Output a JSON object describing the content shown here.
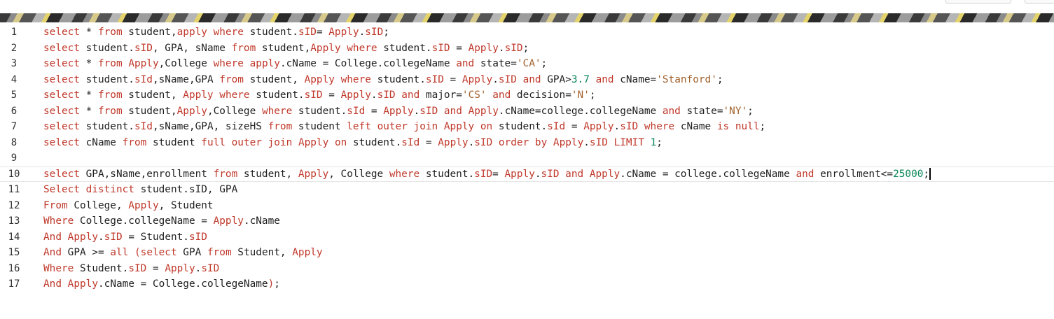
{
  "editor": {
    "colors": {
      "keyword": "#c0392b",
      "string": "#a2622d",
      "number": "#098658",
      "text": "#1f1f1f",
      "gutter": "#333333"
    },
    "active_line": 10,
    "lines": [
      {
        "n": "1",
        "tokens": [
          [
            "kw",
            "select"
          ],
          [
            "plain",
            " * "
          ],
          [
            "kw",
            "from"
          ],
          [
            "plain",
            " student,"
          ],
          [
            "kw",
            "apply"
          ],
          [
            "plain",
            " "
          ],
          [
            "kw",
            "where"
          ],
          [
            "plain",
            " student."
          ],
          [
            "kw",
            "sID"
          ],
          [
            "plain",
            "= "
          ],
          [
            "kw",
            "Apply"
          ],
          [
            "plain",
            "."
          ],
          [
            "kw",
            "sID"
          ],
          [
            "plain",
            ";"
          ]
        ]
      },
      {
        "n": "2",
        "tokens": [
          [
            "kw",
            "select"
          ],
          [
            "plain",
            " student."
          ],
          [
            "kw",
            "sID"
          ],
          [
            "plain",
            ", GPA, sName "
          ],
          [
            "kw",
            "from"
          ],
          [
            "plain",
            " student,"
          ],
          [
            "kw",
            "Apply"
          ],
          [
            "plain",
            " "
          ],
          [
            "kw",
            "where"
          ],
          [
            "plain",
            " student."
          ],
          [
            "kw",
            "sID"
          ],
          [
            "plain",
            " = "
          ],
          [
            "kw",
            "Apply"
          ],
          [
            "plain",
            "."
          ],
          [
            "kw",
            "sID"
          ],
          [
            "plain",
            ";"
          ]
        ]
      },
      {
        "n": "3",
        "tokens": [
          [
            "kw",
            "select"
          ],
          [
            "plain",
            " * "
          ],
          [
            "kw",
            "from"
          ],
          [
            "plain",
            " "
          ],
          [
            "kw",
            "Apply"
          ],
          [
            "plain",
            ",College "
          ],
          [
            "kw",
            "where"
          ],
          [
            "plain",
            " "
          ],
          [
            "kw",
            "apply"
          ],
          [
            "plain",
            ".cName = College.collegeName "
          ],
          [
            "kw",
            "and"
          ],
          [
            "plain",
            " state="
          ],
          [
            "str",
            "'CA'"
          ],
          [
            "plain",
            ";"
          ]
        ]
      },
      {
        "n": "4",
        "tokens": [
          [
            "kw",
            "select"
          ],
          [
            "plain",
            " student."
          ],
          [
            "kw",
            "sId"
          ],
          [
            "plain",
            ",sName,GPA "
          ],
          [
            "kw",
            "from"
          ],
          [
            "plain",
            " student, "
          ],
          [
            "kw",
            "Apply"
          ],
          [
            "plain",
            " "
          ],
          [
            "kw",
            "where"
          ],
          [
            "plain",
            " student."
          ],
          [
            "kw",
            "sID"
          ],
          [
            "plain",
            " = "
          ],
          [
            "kw",
            "Apply"
          ],
          [
            "plain",
            "."
          ],
          [
            "kw",
            "sID"
          ],
          [
            "plain",
            " "
          ],
          [
            "kw",
            "and"
          ],
          [
            "plain",
            " GPA>"
          ],
          [
            "num",
            "3.7"
          ],
          [
            "plain",
            " "
          ],
          [
            "kw",
            "and"
          ],
          [
            "plain",
            " cName="
          ],
          [
            "str",
            "'Stanford'"
          ],
          [
            "plain",
            ";"
          ]
        ]
      },
      {
        "n": "5",
        "tokens": [
          [
            "kw",
            "select"
          ],
          [
            "plain",
            " * "
          ],
          [
            "kw",
            "from"
          ],
          [
            "plain",
            " student, "
          ],
          [
            "kw",
            "Apply"
          ],
          [
            "plain",
            " "
          ],
          [
            "kw",
            "where"
          ],
          [
            "plain",
            " student."
          ],
          [
            "kw",
            "sID"
          ],
          [
            "plain",
            " = "
          ],
          [
            "kw",
            "Apply"
          ],
          [
            "plain",
            "."
          ],
          [
            "kw",
            "sID"
          ],
          [
            "plain",
            " "
          ],
          [
            "kw",
            "and"
          ],
          [
            "plain",
            " major="
          ],
          [
            "str",
            "'CS'"
          ],
          [
            "plain",
            " "
          ],
          [
            "kw",
            "and"
          ],
          [
            "plain",
            " decision="
          ],
          [
            "str",
            "'N'"
          ],
          [
            "plain",
            ";"
          ]
        ]
      },
      {
        "n": "6",
        "tokens": [
          [
            "kw",
            "select"
          ],
          [
            "plain",
            " * "
          ],
          [
            "kw",
            "from"
          ],
          [
            "plain",
            " student,"
          ],
          [
            "kw",
            "Apply"
          ],
          [
            "plain",
            ",College "
          ],
          [
            "kw",
            "where"
          ],
          [
            "plain",
            " student."
          ],
          [
            "kw",
            "sId"
          ],
          [
            "plain",
            " = "
          ],
          [
            "kw",
            "Apply"
          ],
          [
            "plain",
            "."
          ],
          [
            "kw",
            "sID"
          ],
          [
            "plain",
            " "
          ],
          [
            "kw",
            "and"
          ],
          [
            "plain",
            " "
          ],
          [
            "kw",
            "Apply"
          ],
          [
            "plain",
            ".cName=college.collegeName "
          ],
          [
            "kw",
            "and"
          ],
          [
            "plain",
            " state="
          ],
          [
            "str",
            "'NY'"
          ],
          [
            "plain",
            ";"
          ]
        ]
      },
      {
        "n": "7",
        "tokens": [
          [
            "kw",
            "select"
          ],
          [
            "plain",
            " student."
          ],
          [
            "kw",
            "sId"
          ],
          [
            "plain",
            ",sName,GPA, sizeHS "
          ],
          [
            "kw",
            "from"
          ],
          [
            "plain",
            " student "
          ],
          [
            "kw",
            "left"
          ],
          [
            "plain",
            " "
          ],
          [
            "kw",
            "outer"
          ],
          [
            "plain",
            " "
          ],
          [
            "kw",
            "join"
          ],
          [
            "plain",
            " "
          ],
          [
            "kw",
            "Apply"
          ],
          [
            "plain",
            " "
          ],
          [
            "kw",
            "on"
          ],
          [
            "plain",
            " student."
          ],
          [
            "kw",
            "sId"
          ],
          [
            "plain",
            " = "
          ],
          [
            "kw",
            "Apply"
          ],
          [
            "plain",
            "."
          ],
          [
            "kw",
            "sID"
          ],
          [
            "plain",
            " "
          ],
          [
            "kw",
            "where"
          ],
          [
            "plain",
            " cName "
          ],
          [
            "kw",
            "is"
          ],
          [
            "plain",
            " "
          ],
          [
            "kw",
            "null"
          ],
          [
            "plain",
            ";"
          ]
        ]
      },
      {
        "n": "8",
        "tokens": [
          [
            "kw",
            "select"
          ],
          [
            "plain",
            " cName "
          ],
          [
            "kw",
            "from"
          ],
          [
            "plain",
            " student "
          ],
          [
            "kw",
            "full"
          ],
          [
            "plain",
            " "
          ],
          [
            "kw",
            "outer"
          ],
          [
            "plain",
            " "
          ],
          [
            "kw",
            "join"
          ],
          [
            "plain",
            " "
          ],
          [
            "kw",
            "Apply"
          ],
          [
            "plain",
            " "
          ],
          [
            "kw",
            "on"
          ],
          [
            "plain",
            " student."
          ],
          [
            "kw",
            "sId"
          ],
          [
            "plain",
            " = "
          ],
          [
            "kw",
            "Apply"
          ],
          [
            "plain",
            "."
          ],
          [
            "kw",
            "sID"
          ],
          [
            "plain",
            " "
          ],
          [
            "kw",
            "order"
          ],
          [
            "plain",
            " "
          ],
          [
            "kw",
            "by"
          ],
          [
            "plain",
            " "
          ],
          [
            "kw",
            "Apply"
          ],
          [
            "plain",
            "."
          ],
          [
            "kw",
            "sID"
          ],
          [
            "plain",
            " "
          ],
          [
            "kw",
            "LIMIT"
          ],
          [
            "plain",
            " "
          ],
          [
            "num",
            "1"
          ],
          [
            "plain",
            ";"
          ]
        ]
      },
      {
        "n": "9",
        "tokens": []
      },
      {
        "n": "10",
        "tokens": [
          [
            "kw",
            "select"
          ],
          [
            "plain",
            " GPA,sName,enrollment "
          ],
          [
            "kw",
            "from"
          ],
          [
            "plain",
            " student, "
          ],
          [
            "kw",
            "Apply"
          ],
          [
            "plain",
            ", College "
          ],
          [
            "kw",
            "where"
          ],
          [
            "plain",
            " student."
          ],
          [
            "kw",
            "sID"
          ],
          [
            "plain",
            "= "
          ],
          [
            "kw",
            "Apply"
          ],
          [
            "plain",
            "."
          ],
          [
            "kw",
            "sID"
          ],
          [
            "plain",
            " "
          ],
          [
            "kw",
            "and"
          ],
          [
            "plain",
            " "
          ],
          [
            "kw",
            "Apply"
          ],
          [
            "plain",
            ".cName = college.collegeName "
          ],
          [
            "kw",
            "and"
          ],
          [
            "plain",
            " enrollment<="
          ],
          [
            "num",
            "25000"
          ],
          [
            "plain",
            ";"
          ]
        ]
      },
      {
        "n": "11",
        "tokens": [
          [
            "kw",
            "Select"
          ],
          [
            "plain",
            " "
          ],
          [
            "kw",
            "distinct"
          ],
          [
            "plain",
            " student.sID, GPA"
          ]
        ]
      },
      {
        "n": "12",
        "tokens": [
          [
            "kw",
            "From"
          ],
          [
            "plain",
            " College, "
          ],
          [
            "kw",
            "Apply"
          ],
          [
            "plain",
            ", Student"
          ]
        ]
      },
      {
        "n": "13",
        "tokens": [
          [
            "kw",
            "Where"
          ],
          [
            "plain",
            " College.collegeName = "
          ],
          [
            "kw",
            "Apply"
          ],
          [
            "plain",
            ".cName"
          ]
        ]
      },
      {
        "n": "14",
        "tokens": [
          [
            "kw",
            "And"
          ],
          [
            "plain",
            " "
          ],
          [
            "kw",
            "Apply"
          ],
          [
            "plain",
            "."
          ],
          [
            "kw",
            "sID"
          ],
          [
            "plain",
            " = Student."
          ],
          [
            "kw",
            "sID"
          ]
        ]
      },
      {
        "n": "15",
        "tokens": [
          [
            "kw",
            "And"
          ],
          [
            "plain",
            " GPA >= "
          ],
          [
            "kw",
            "all"
          ],
          [
            "plain",
            " "
          ],
          [
            "kw",
            "("
          ],
          [
            "kw",
            "select"
          ],
          [
            "plain",
            " GPA "
          ],
          [
            "kw",
            "from"
          ],
          [
            "plain",
            " Student, "
          ],
          [
            "kw",
            "Apply"
          ]
        ]
      },
      {
        "n": "16",
        "tokens": [
          [
            "kw",
            "Where"
          ],
          [
            "plain",
            " Student."
          ],
          [
            "kw",
            "sID"
          ],
          [
            "plain",
            " = "
          ],
          [
            "kw",
            "Apply"
          ],
          [
            "plain",
            "."
          ],
          [
            "kw",
            "sID"
          ]
        ]
      },
      {
        "n": "17",
        "tokens": [
          [
            "kw",
            "And"
          ],
          [
            "plain",
            " "
          ],
          [
            "kw",
            "Apply"
          ],
          [
            "plain",
            ".cName = College.collegeName"
          ],
          [
            "kw",
            ")"
          ],
          [
            "plain",
            ";"
          ]
        ]
      }
    ]
  }
}
